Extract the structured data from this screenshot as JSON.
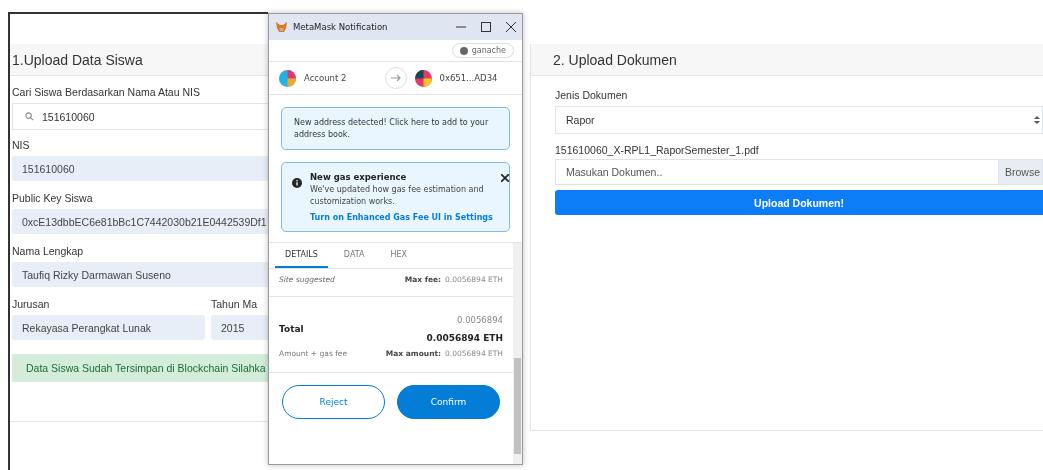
{
  "student_card": {
    "title": "1.Upload Data Siswa",
    "search": {
      "label": "Cari Siswa Berdasarkan Nama Atau NIS",
      "value": "151610060"
    },
    "fields": [
      {
        "label": "NIS",
        "value": "151610060"
      },
      {
        "label": "Public Key Siswa",
        "value": "0xcE13dbbEC6e81bBc1C7442030b21E0442539Df1"
      },
      {
        "label": "Nama Lengkap",
        "value": "Taufiq Rizky Darmawan Suseno"
      }
    ],
    "major": {
      "label": "Jurusan",
      "value": "Rekayasa Perangkat Lunak"
    },
    "year": {
      "label": "Tahun Ma",
      "value": "2015"
    },
    "alert": "Data Siswa Sudah Tersimpan di Blockchain Silahka"
  },
  "metamask": {
    "title": "MetaMask Notification",
    "network": "ganache",
    "from_account": "Account 2",
    "to_account": "0x651...AD34",
    "address_notice": "New address detected! Click here to add to your address book.",
    "gas_notice": {
      "title": "New gas experience",
      "text": "We've updated how gas fee estimation and customization works.",
      "link": "Turn on Enhanced Gas Fee UI in Settings"
    },
    "tabs": [
      {
        "label": "DETAILS",
        "selected": true
      },
      {
        "label": "DATA",
        "selected": false
      },
      {
        "label": "HEX",
        "selected": false
      }
    ],
    "fee": {
      "label": "Site suggested",
      "max_label": "Max fee:",
      "max_value": "0.0056894 ETH"
    },
    "total": {
      "label": "Total",
      "amount": "0.0056894",
      "amount_bold": "0.0056894 ETH",
      "sublabel": "Amount + gas fee",
      "max_label": "Max amount:",
      "max_value": "0.0056894 ETH"
    },
    "buttons": {
      "reject": "Reject",
      "confirm": "Confirm"
    }
  },
  "document_card": {
    "title": "2. Upload Dokumen",
    "doc_type_label": "Jenis Dokumen",
    "doc_type_value": "Rapor",
    "file_name": "151610060_X-RPL1_RaporSemester_1.pdf",
    "file_placeholder": "Masukan Dokumen..",
    "browse": "Browse",
    "upload": "Upload Dokumen!"
  }
}
